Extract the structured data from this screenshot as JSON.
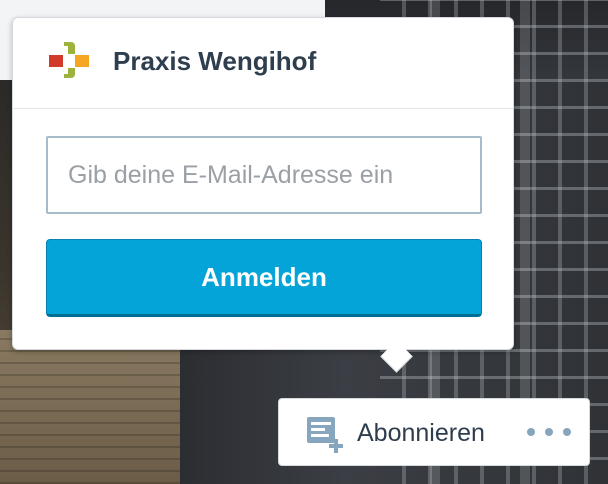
{
  "site": {
    "name": "Praxis Wengihof",
    "logo_icon": "praxis-cross-logo",
    "logo_colors": [
      "#d23a2b",
      "#f5a623",
      "#9bb33c"
    ]
  },
  "signup": {
    "email_placeholder": "Gib deine E-Mail-Adresse ein",
    "email_value": "",
    "button_label": "Anmelden",
    "button_color": "#04a4d8"
  },
  "subscribe_bar": {
    "follow_icon": "reader-subscribe-icon",
    "follow_label": "Abonnieren",
    "more_icon": "ellipsis-icon"
  }
}
